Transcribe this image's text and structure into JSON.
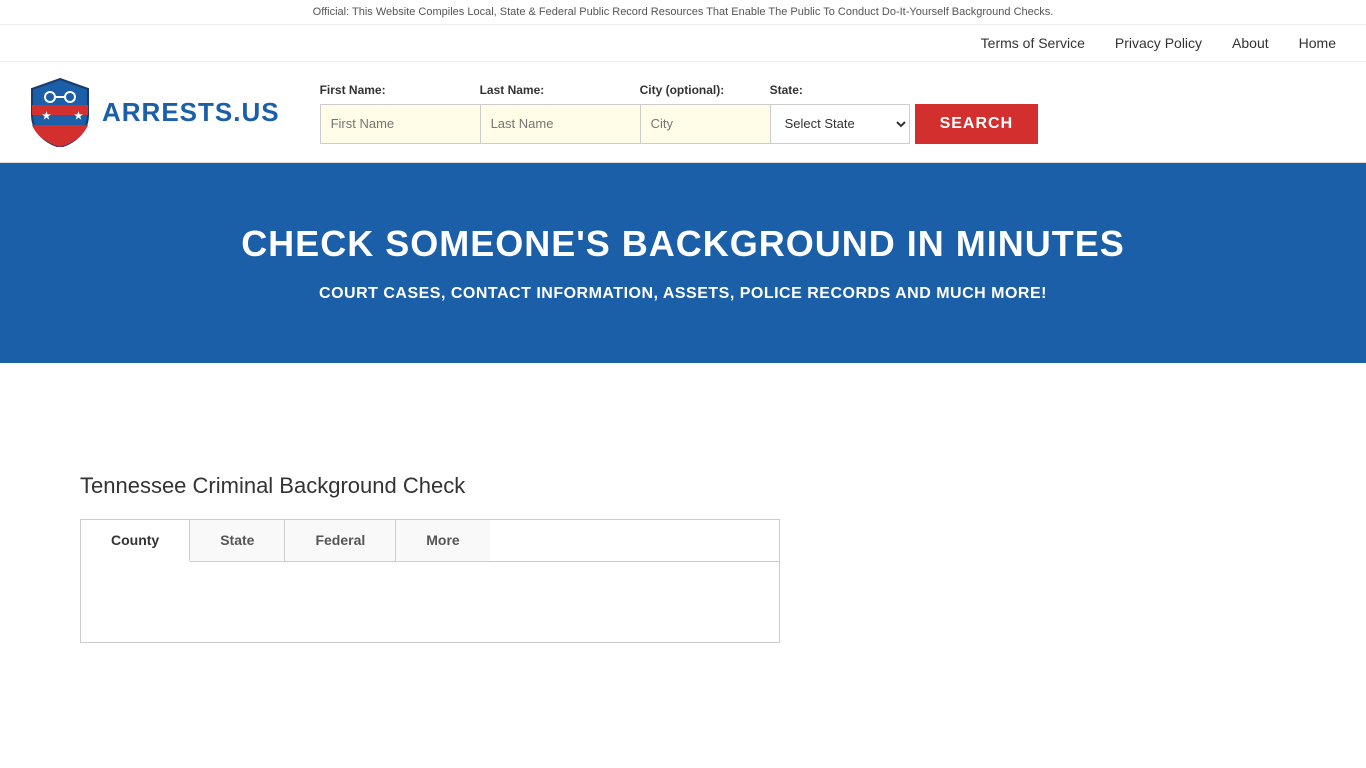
{
  "announcement": {
    "text": "Official: This Website Compiles Local, State & Federal Public Record Resources That Enable The Public To Conduct Do-It-Yourself Background Checks."
  },
  "nav": {
    "links": [
      {
        "label": "Terms of Service",
        "name": "terms-link"
      },
      {
        "label": "Privacy Policy",
        "name": "privacy-link"
      },
      {
        "label": "About",
        "name": "about-link"
      },
      {
        "label": "Home",
        "name": "home-link"
      }
    ]
  },
  "logo": {
    "text": "ARRESTS.US",
    "icon_alt": "Arrests.us shield logo"
  },
  "search": {
    "first_name_label": "First Name:",
    "last_name_label": "Last Name:",
    "city_label": "City (optional):",
    "state_label": "State:",
    "first_name_placeholder": "First Name",
    "last_name_placeholder": "Last Name",
    "city_placeholder": "City",
    "state_placeholder": "Select State",
    "search_button_label": "SEARCH"
  },
  "hero": {
    "title": "CHECK SOMEONE'S BACKGROUND IN MINUTES",
    "subtitle": "COURT CASES, CONTACT INFORMATION, ASSETS, POLICE RECORDS AND MUCH MORE!"
  },
  "main": {
    "section_title": "Tennessee Criminal Background Check",
    "tabs": [
      {
        "label": "County",
        "active": true
      },
      {
        "label": "State",
        "active": false
      },
      {
        "label": "Federal",
        "active": false
      },
      {
        "label": "More",
        "active": false
      }
    ]
  },
  "colors": {
    "brand_blue": "#1a5fa8",
    "brand_red": "#d32f2f",
    "hero_bg": "#1a5fa8",
    "input_bg": "#fffde7"
  }
}
